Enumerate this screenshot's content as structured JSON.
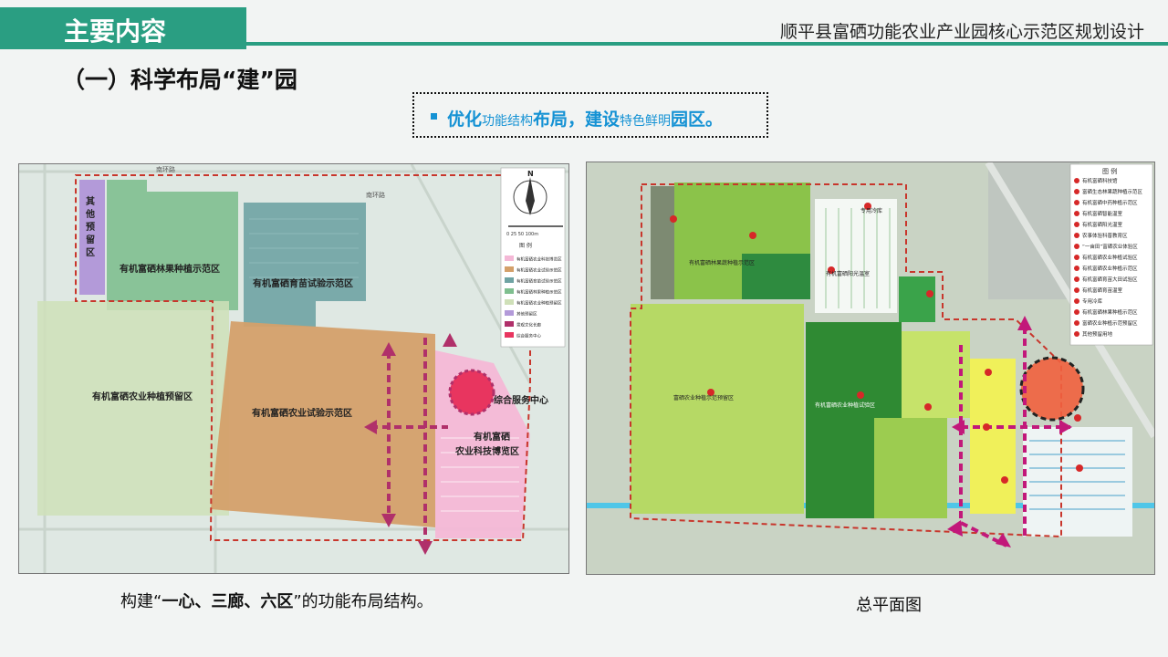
{
  "header": {
    "tab_title": "主要内容",
    "project_title": "顺平县富硒功能农业产业园核心示范区规划设计"
  },
  "section": {
    "heading": "（一）科学布局“建”园"
  },
  "callout": {
    "part1_big": "优化",
    "part2_small": "功能结构",
    "part3_big": "布局，建设",
    "part4_small": "特色鲜明",
    "part5_big": "园区。"
  },
  "left_map": {
    "zones": {
      "reserve_other": "其他预留区",
      "fruit_forest": "有机富硒林果种植示范区",
      "seedling": "有机富硒育苗试验示范区",
      "planting_reserve": "有机富硒农业种植预留区",
      "trial": "有机富硒农业试验示范区",
      "expo_line1": "有机富硒",
      "expo_line2": "农业科技博览区",
      "service_center": "综合服务中心"
    },
    "roads": {
      "north": "南环路",
      "north2": "南环路"
    },
    "compass": {
      "north_label": "N",
      "scale_text": "0  25  50      100m"
    },
    "legend": {
      "title": "图  例",
      "items": [
        {
          "label": "有机富硒农业科技博览区",
          "color": "#f4b8d6"
        },
        {
          "label": "有机富硒农业试验示范区",
          "color": "#d4a06a"
        },
        {
          "label": "有机富硒育苗试验示范区",
          "color": "#6fa3a3"
        },
        {
          "label": "有机富硒林果种植示范区",
          "color": "#7fbf8f"
        },
        {
          "label": "有机富硒农业种植预留区",
          "color": "#cfe0b8"
        },
        {
          "label": "其他预留区",
          "color": "#b39ad9"
        },
        {
          "label": "景观文化长廊",
          "color": "#b0306a"
        },
        {
          "label": "综合服务中心",
          "color": "#e8355f"
        }
      ]
    }
  },
  "right_map": {
    "legend": {
      "title": "图  例",
      "items": [
        "有机富硒科技馆",
        "富硒生态林果蔬种植示范区",
        "有机富硒中药种植示范区",
        "有机富硒智能温室",
        "有机富硒阳光温室",
        "农事体验科普教育区",
        "“一亩田”富硒农业体验区",
        "有机富硒农业种植试验区",
        "有机富硒农业种植示范区",
        "有机富硒育苗大田试验区",
        "有机富硒育苗温室",
        "专用冷库",
        "有机富硒林果种植示范区",
        "富硒农业种植示范预留区",
        "其他预留用地"
      ]
    },
    "labels": {
      "fruit_veg": "有机富硒林果蔬种植示范区",
      "planting_reserve": "富硒农业种植示范预留区",
      "trial": "有机富硒农业种植试验区",
      "cold_storage": "专用冷库",
      "greenhouse": "有机富硒阳光温室"
    }
  },
  "captions": {
    "left_prefix": "构建“",
    "left_bold": "一心、三廊、六区",
    "left_suffix": "”的功能布局结构。",
    "right": "总平面图"
  }
}
